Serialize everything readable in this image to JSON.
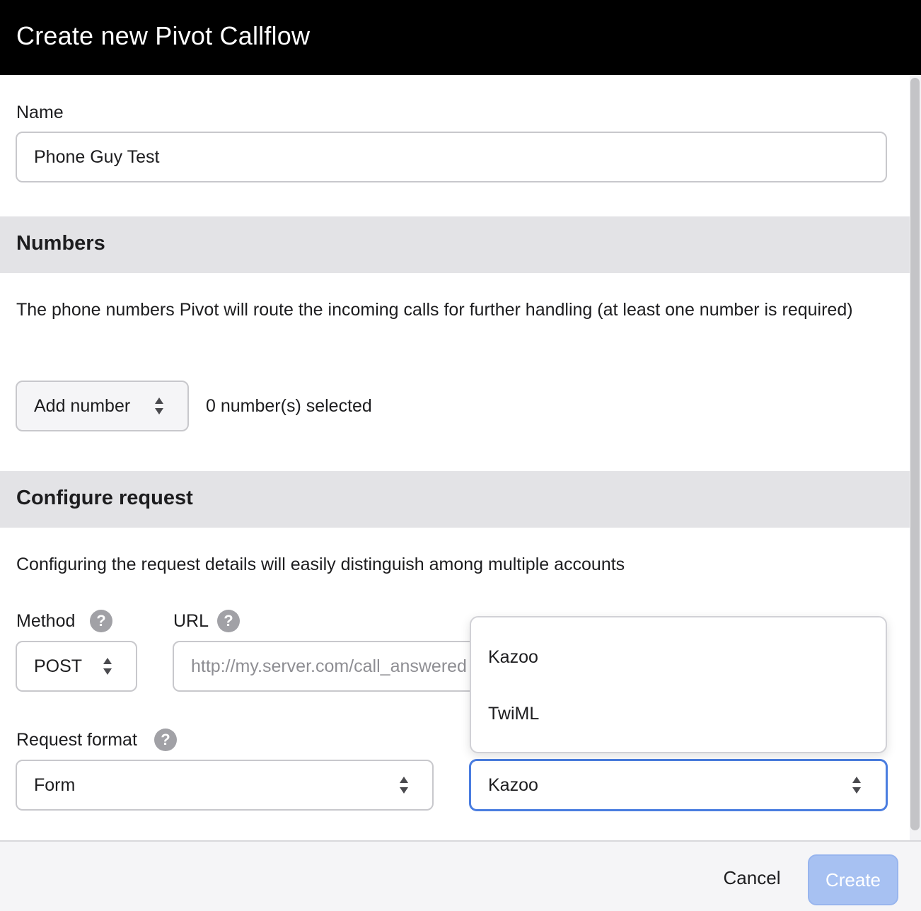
{
  "dialog": {
    "title": "Create new Pivot Callflow"
  },
  "name_field": {
    "label": "Name",
    "value": "Phone Guy Test"
  },
  "numbers_section": {
    "title": "Numbers",
    "description": "The phone numbers Pivot will route the incoming calls for further handling (at least one number is required)",
    "add_number_label": "Add number",
    "selected_count": "0 number(s) selected"
  },
  "configure_section": {
    "title": "Configure request",
    "description": "Configuring the request details will easily distinguish among multiple accounts",
    "method_label": "Method",
    "method_value": "POST",
    "url_label": "URL",
    "url_placeholder": "http://my.server.com/call_answered",
    "request_format_label": "Request format",
    "request_format_value": "Form",
    "response_format_value": "Kazoo",
    "response_format_options": [
      "Kazoo",
      "TwiML"
    ]
  },
  "footer": {
    "cancel_label": "Cancel",
    "create_label": "Create"
  },
  "colors": {
    "header_bg": "#000000",
    "section_band": "#e3e3e6",
    "focus_blue": "#4a7de0",
    "create_disabled": "#a7c1f2"
  },
  "icons": {
    "help": "question-circle-icon",
    "select_arrows": "up-down-arrows-icon"
  }
}
